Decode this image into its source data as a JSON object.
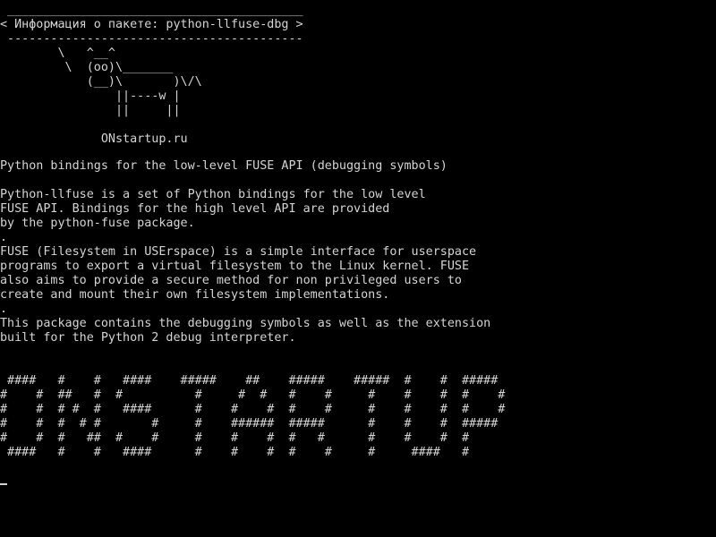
{
  "colors": {
    "background": "#000000",
    "foreground": "#d4d4d4"
  },
  "cowsay": {
    "border_top": " _________________________________________",
    "speech": "< Информация о пакете: python-llfuse-dbg >",
    "border_bottom": " -----------------------------------------",
    "cow": [
      "        \\   ^__^",
      "         \\  (oo)\\_______",
      "            (__)\\       )\\/\\",
      "                ||----w |",
      "                ||     ||"
    ],
    "site": "              ONstartup.ru"
  },
  "package": {
    "summary": "Python bindings for the low-level FUSE API (debugging symbols)",
    "description": [
      "Python-llfuse is a set of Python bindings for the low level",
      "FUSE API. Bindings for the high level API are provided",
      "by the python-fuse package.",
      ".",
      "FUSE (Filesystem in USErspace) is a simple interface for userspace",
      "programs to export a virtual filesystem to the Linux kernel. FUSE",
      "also aims to provide a secure method for non privileged users to",
      "create and mount their own filesystem implementations.",
      ".",
      "This package contains the debugging symbols as well as the extension",
      "built for the Python 2 debug interpreter."
    ]
  },
  "banner": {
    "lines": [
      " ####   #    #   ####    #####    ##    #####    #####  #    #  #####",
      "#    #  ##   #  #          #     #  #   #    #     #    #    #  #    #",
      "#    #  # #  #   ####      #    #    #  #    #     #    #    #  #    #",
      "#    #  #  # #       #     #    ######  #####      #    #    #  #####",
      "#    #  #   ##  #    #     #    #    #  #   #      #    #    #  #",
      " ####   #    #   ####      #    #    #  #    #     #     ####   #"
    ]
  }
}
